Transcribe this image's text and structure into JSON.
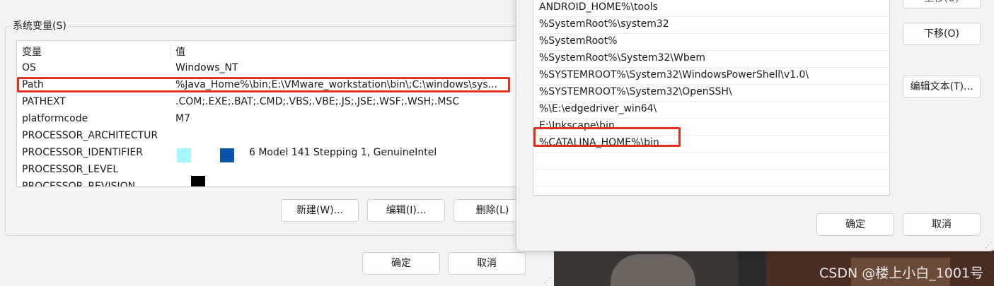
{
  "system_vars": {
    "group_title": "系统变量(S)",
    "columns": {
      "name": "变量",
      "value": "值"
    },
    "rows": [
      {
        "name": "OS",
        "value": "Windows_NT"
      },
      {
        "name": "Path",
        "value": "%Java_Home%\\bin;E:\\VMware_workstation\\bin\\;C:\\windows\\sys..."
      },
      {
        "name": "PATHEXT",
        "value": ".COM;.EXE;.BAT;.CMD;.VBS;.VBE;.JS;.JSE;.WSF;.WSH;.MSC"
      },
      {
        "name": "platformcode",
        "value": "M7"
      },
      {
        "name": "PROCESSOR_ARCHITECTUR",
        "value": ""
      },
      {
        "name": "PROCESSOR_IDENTIFIER",
        "value": "6 Model 141 Stepping 1, GenuineIntel"
      },
      {
        "name": "PROCESSOR_LEVEL",
        "value": ""
      },
      {
        "name": "PROCESSOR_REVISION",
        "value": ""
      }
    ],
    "buttons": {
      "new": "新建(W)...",
      "edit": "编辑(I)...",
      "delete": "删除(L)"
    }
  },
  "footer": {
    "ok": "确定",
    "cancel": "取消"
  },
  "edit_dialog": {
    "items": [
      "ANDROID_HOME%\\tools",
      "%SystemRoot%\\system32",
      "%SystemRoot%",
      "%SystemRoot%\\System32\\Wbem",
      "%SYSTEMROOT%\\System32\\WindowsPowerShell\\v1.0\\",
      "%SYSTEMROOT%\\System32\\OpenSSH\\",
      "%\\E:\\edgedriver_win64\\",
      "E:\\Inkscape\\bin",
      "%CATALINA_HOME%\\bin"
    ],
    "buttons": {
      "up": "上移(U)",
      "down": "下移(O)",
      "edit_text": "编辑文本(T)..."
    },
    "ok": "确定",
    "cancel": "取消"
  },
  "watermark": "CSDN @楼上小白_1001号",
  "colors": {
    "highlight": "#e0301e",
    "accent_cyan": "#a6f6ff",
    "accent_blue": "#0a55a8"
  }
}
